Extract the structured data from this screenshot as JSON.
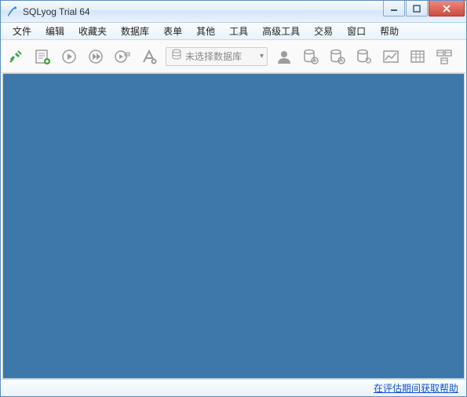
{
  "window": {
    "title": "SQLyog Trial 64"
  },
  "menu": {
    "items": [
      "文件",
      "编辑",
      "收藏夹",
      "数据库",
      "表单",
      "其他",
      "工具",
      "高级工具",
      "交易",
      "窗口",
      "帮助"
    ]
  },
  "toolbar": {
    "icons": {
      "connect": "connect-icon",
      "new_query": "new-query-icon",
      "execute": "execute-icon",
      "execute_all": "execute-all-icon",
      "execute_explain": "execute-explain-icon",
      "format": "format-icon",
      "user": "user-icon",
      "backup": "backup-icon",
      "schedule": "schedule-icon",
      "sync": "sync-icon",
      "visual": "visual-icon",
      "table": "table-icon",
      "schema": "schema-icon"
    },
    "db_select_placeholder": "未选择数据库"
  },
  "status": {
    "help_link": "在评估期间获取帮助"
  }
}
